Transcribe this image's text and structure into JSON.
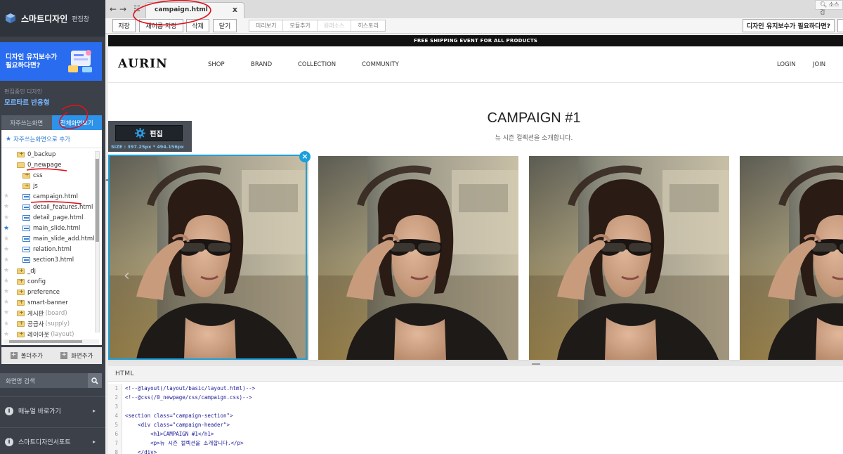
{
  "sidebar": {
    "brand_name": "스마트디자인",
    "brand_sub": "편집창",
    "promo_text_line1": "디자인 유지보수가",
    "promo_text_line2": "필요하다면?",
    "current_design_label": "편집중인 디자인",
    "current_design_name": "모르타르 반응형",
    "tabs": [
      "자주쓰는화면",
      "전체화면보기"
    ],
    "favorites_link": "자주쓰는화면으로 추가",
    "tree": [
      {
        "label": "0_backup",
        "type": "folder"
      },
      {
        "label": "0_newpage",
        "type": "folder-open"
      },
      {
        "label": "css",
        "type": "folder"
      },
      {
        "label": "js",
        "type": "folder"
      },
      {
        "label": "campaign.html",
        "type": "file"
      },
      {
        "label": "detail_features.html",
        "type": "file"
      },
      {
        "label": "detail_page.html",
        "type": "file"
      },
      {
        "label": "main_slide.html",
        "type": "file"
      },
      {
        "label": "main_slide_add.html",
        "type": "file"
      },
      {
        "label": "relation.html",
        "type": "file"
      },
      {
        "label": "section3.html",
        "type": "file"
      },
      {
        "label": "_dj",
        "type": "folder"
      },
      {
        "label": "config",
        "type": "folder"
      },
      {
        "label": "preference",
        "type": "folder"
      },
      {
        "label": "smart-banner",
        "type": "folder"
      },
      {
        "label": "게시판",
        "note": "(board)",
        "type": "folder"
      },
      {
        "label": "공급사",
        "note": "(supply)",
        "type": "folder"
      },
      {
        "label": "레이아웃",
        "note": "(layout)",
        "type": "folder"
      }
    ],
    "add_folder": "폴더추가",
    "add_screen": "화면추가",
    "search_placeholder": "화면명 검색",
    "menu": [
      "매뉴얼 바로가기",
      "스마트디자인서포트"
    ]
  },
  "topbar": {
    "back": "←",
    "forward": "→",
    "tab_label": "campaign.html",
    "close": "x",
    "right_search": "소스 검"
  },
  "toolbar": {
    "save": "저장",
    "save_as": "새이름 저장",
    "delete": "삭제",
    "close": "닫기",
    "preview": "미리보기",
    "module_add": "모듈추가",
    "restore": "원래소스",
    "history": "히스토리",
    "promo": "디자인 유지보수가 필요하다면?"
  },
  "preview": {
    "shipping": "FREE SHIPPING EVENT FOR ALL PRODUCTS",
    "logo": "AURIN",
    "nav": [
      "SHOP",
      "BRAND",
      "COLLECTION",
      "COMMUNITY"
    ],
    "util": [
      "LOGIN",
      "JOIN"
    ],
    "title": "CAMPAIGN #1",
    "desc": "뉴 시즌 컬렉션을 소개합니다.",
    "edit_button": "편집",
    "size": "SIZE : 397.25px * 494.156px"
  },
  "code": {
    "title": "HTML",
    "lines": [
      {
        "n": "1",
        "t": "<!--@layout(/layout/basic/layout.html)-->",
        "k": "comment"
      },
      {
        "n": "2",
        "t": "<!--@css(/0_newpage/css/campaign.css)-->",
        "k": "comment"
      },
      {
        "n": "3",
        "t": "",
        "k": "text"
      },
      {
        "n": "4",
        "t": "<section class=\"campaign-section\">",
        "k": "tag"
      },
      {
        "n": "5",
        "t": "    <div class=\"campaign-header\">",
        "k": "tag"
      },
      {
        "n": "6",
        "t": "        <h1>CAMPAIGN #1</h1>",
        "k": "tag"
      },
      {
        "n": "7",
        "t": "        <p>뉴 시즌 컬렉션을 소개합니다.</p>",
        "k": "tag"
      },
      {
        "n": "8",
        "t": "    </div>",
        "k": "tag"
      }
    ]
  },
  "colors": {
    "sidebar_bg": "#3b4049",
    "accent": "#2d92e8",
    "selection": "#1aa0dc",
    "annotation": "#e0121c"
  }
}
